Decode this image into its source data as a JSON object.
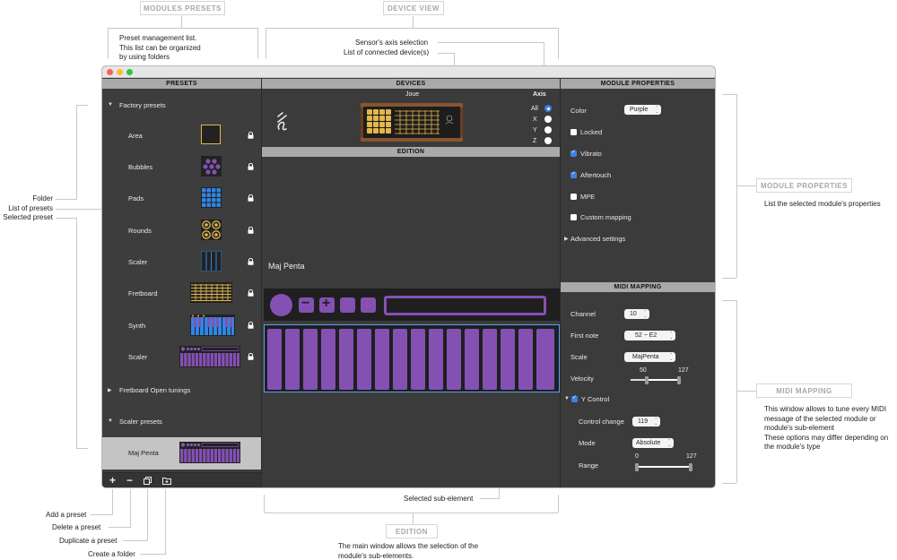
{
  "annotations": {
    "modules_presets_tag": "MODULES PRESETS",
    "device_view_tag": "DEVICE VIEW",
    "module_properties_tag": "MODULE PROPERTIES",
    "midi_mapping_tag": "MIDI MAPPING",
    "edition_tag": "EDITION",
    "preset_note": [
      "Preset management list.",
      "This list can be organized",
      "by using folders"
    ],
    "axis_note": "Sensor's axis selection",
    "devices_note": "List of connected device(s)",
    "folder_note": "Folder",
    "list_note": "List of presets",
    "selected_note": "Selected preset",
    "props_note": "List the selected module's properties",
    "midi_note": [
      "This window allows to tune every MIDI",
      "message of the selected module or",
      "module's sub-element",
      "These options may differ depending on",
      "the module's type"
    ],
    "subelement_note": "Selected sub-element",
    "edition_note": [
      "The main window allows the selection of the",
      "module's sub-elements."
    ],
    "add_note": "Add a preset",
    "delete_note": "Delete a preset",
    "duplicate_note": "Duplicate a preset",
    "folder_create_note": "Create a folder"
  },
  "window": {
    "colors": {
      "close": "#fc5f57",
      "minimize": "#fdbc2e",
      "zoom": "#29c840",
      "accent": "#3b82e0",
      "module_purple": "#8451b3",
      "fretboard_gold": "#e3b74a"
    }
  },
  "presets": {
    "header": "PRESETS",
    "groups": {
      "factory": "Factory presets",
      "fretboard_open": "Fretboard Open tunings",
      "scaler_presets": "Scaler presets"
    },
    "factory_items": [
      "Area",
      "Bubbles",
      "Pads",
      "Rounds",
      "Scaler",
      "Fretboard",
      "Synth",
      "Scaler"
    ],
    "selected_item": "Maj Penta",
    "toolbar": {
      "add": "+",
      "delete": "−"
    }
  },
  "devices": {
    "header": "DEVICES",
    "device_name": "Joue",
    "axis_title": "Axis",
    "axis_options": [
      "All",
      "X",
      "Y",
      "Z"
    ],
    "axis_selected": "All"
  },
  "edition": {
    "header": "EDITION",
    "module_name": "Maj Penta",
    "minus": "−",
    "plus": "+"
  },
  "module_properties": {
    "header": "MODULE PROPERTIES",
    "color_label": "Color",
    "color_value": "Purple",
    "locked": "Locked",
    "vibrato": "Vibrato",
    "aftertouch": "Aftertouch",
    "mpe": "MPE",
    "custom_mapping": "Custom mapping",
    "advanced": "Advanced settings"
  },
  "midi_mapping": {
    "header": "MIDI MAPPING",
    "channel_label": "Channel",
    "channel_value": "10",
    "first_note_label": "First note",
    "first_note_value": "52 ~ E2",
    "scale_label": "Scale",
    "scale_value": "MajPenta",
    "velocity_label": "Velocity",
    "velocity_min": "50",
    "velocity_max": "127",
    "y_control": "Y Control",
    "control_change_label": "Control change",
    "control_change_value": "119",
    "mode_label": "Mode",
    "mode_value": "Absolute",
    "range_label": "Range",
    "range_min": "0",
    "range_max": "127"
  }
}
